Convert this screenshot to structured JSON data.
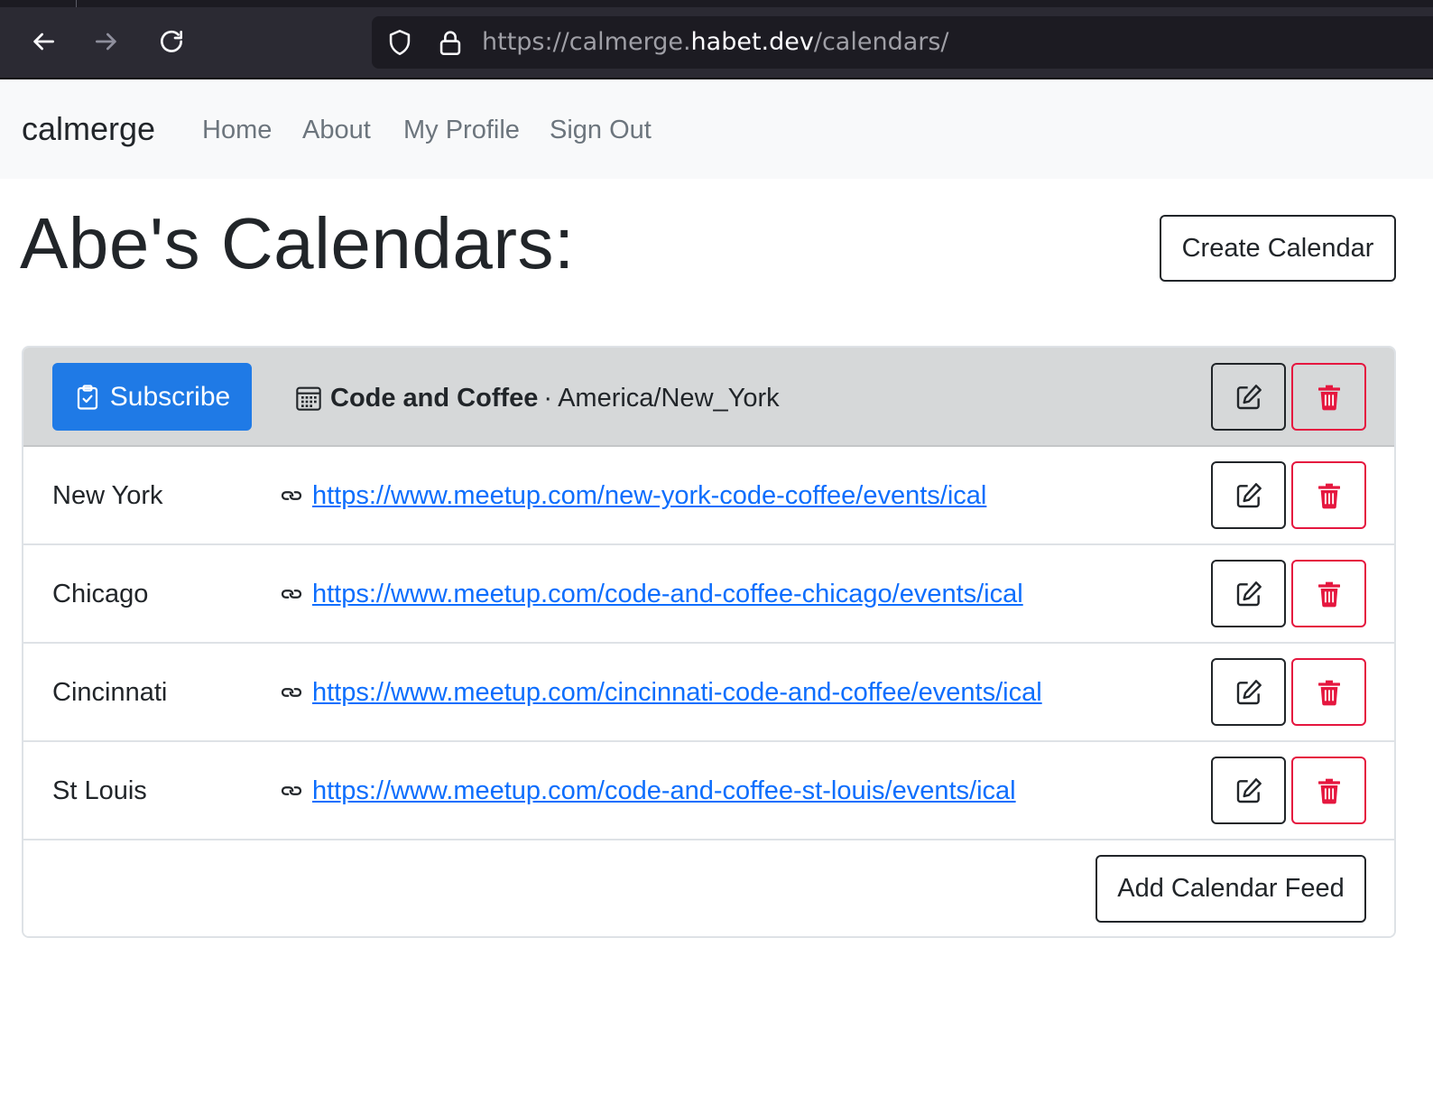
{
  "browser": {
    "url_prefix": "https://calmerge.",
    "url_host": "habet.dev",
    "url_path": "/calendars/"
  },
  "navbar": {
    "brand": "calmerge",
    "links": [
      "Home",
      "About",
      "My Profile",
      "Sign Out"
    ]
  },
  "page": {
    "title": "Abe's Calendars:",
    "create_button": "Create Calendar"
  },
  "calendar": {
    "subscribe_label": "Subscribe",
    "name": "Code and Coffee",
    "separator": "·",
    "timezone": "America/New_York",
    "feeds": [
      {
        "name": "New York",
        "url": "https://www.meetup.com/new-york-code-coffee/events/ical"
      },
      {
        "name": "Chicago",
        "url": "https://www.meetup.com/code-and-coffee-chicago/events/ical"
      },
      {
        "name": "Cincinnati",
        "url": "https://www.meetup.com/cincinnati-code-and-coffee/events/ical"
      },
      {
        "name": "St Louis",
        "url": "https://www.meetup.com/code-and-coffee-st-louis/events/ical"
      }
    ],
    "add_feed_label": "Add Calendar Feed"
  },
  "colors": {
    "primary": "#1f7ae6",
    "danger": "#e5173f",
    "link": "#0d6efd",
    "header_bg": "#d6d8d9"
  }
}
